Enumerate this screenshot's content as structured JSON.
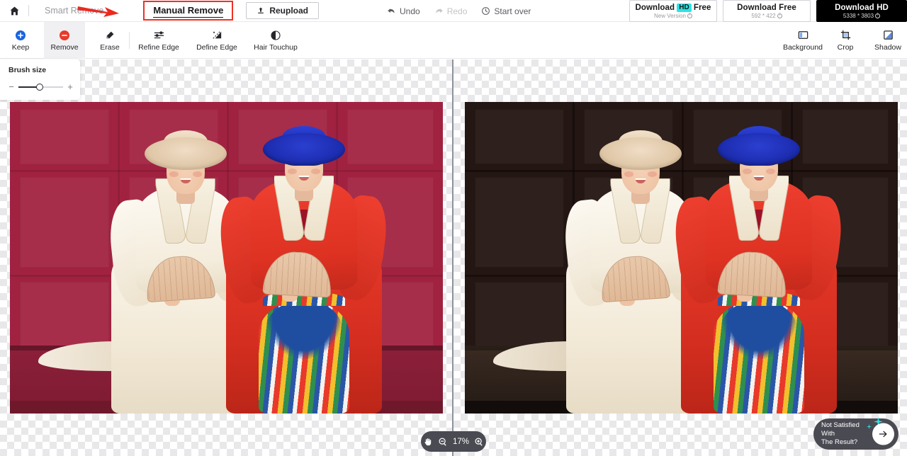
{
  "topbar": {
    "home_icon": "home-icon",
    "tabs": [
      {
        "label": "Smart Remove",
        "active": false
      },
      {
        "label": "Manual Remove",
        "active": true
      }
    ],
    "reupload_label": "Reupload",
    "reupload_icon": "upload-icon",
    "history": [
      {
        "label": "Undo",
        "icon": "undo-arrow-icon",
        "enabled": true
      },
      {
        "label": "Redo",
        "icon": "redo-arrow-icon",
        "enabled": false
      },
      {
        "label": "Start over",
        "icon": "clock-reset-icon",
        "enabled": true
      }
    ],
    "downloads": [
      {
        "title_pre": "Download",
        "badge": "HD",
        "title_post": "Free",
        "subtitle": "New Version",
        "dark": false
      },
      {
        "title_pre": "Download Free",
        "badge": "",
        "title_post": "",
        "subtitle": "592 * 422",
        "dark": false
      },
      {
        "title_pre": "Download HD",
        "badge": "",
        "title_post": "",
        "subtitle": "5338 * 3803",
        "dark": true
      }
    ]
  },
  "toolbar": {
    "left_tools": [
      {
        "label": "Keep",
        "icon": "plus-circle-icon",
        "selected": false
      },
      {
        "label": "Remove",
        "icon": "minus-circle-icon",
        "selected": true
      },
      {
        "label": "Erase",
        "icon": "eraser-icon",
        "selected": false
      },
      {
        "label": "Refine Edge",
        "icon": "sliders-icon",
        "selected": false
      },
      {
        "label": "Define Edge",
        "icon": "edge-pen-icon",
        "selected": false
      },
      {
        "label": "Hair Touchup",
        "icon": "hair-contrast-icon",
        "selected": false
      }
    ],
    "right_tools": [
      {
        "label": "Background",
        "icon": "background-panel-icon"
      },
      {
        "label": "Crop",
        "icon": "crop-icon"
      },
      {
        "label": "Shadow",
        "icon": "shadow-icon"
      }
    ]
  },
  "brush_panel": {
    "title": "Brush size",
    "minus": "−",
    "plus": "+"
  },
  "zoombar": {
    "hand_icon": "hand-pan-icon",
    "zoom_out_icon": "zoom-out-icon",
    "zoom_level": "17%",
    "zoom_in_icon": "zoom-in-icon"
  },
  "cta": {
    "line1": "Not Satisfied With",
    "line2": "The Result?",
    "arrow_icon": "arrow-right-icon",
    "sparkle_icon": "sparkle-icon"
  },
  "canvas": {
    "left_photo_alt": "original-photo-red-background",
    "right_photo_alt": "result-photo-dark-background",
    "divider": "comparison-slider-divider"
  },
  "annotation": {
    "arrow_icon": "red-annotation-arrow",
    "highlight_color": "#ef3124"
  },
  "colors": {
    "accent_red": "#ef3124",
    "badge_cyan": "#2ee3e3",
    "toolbar_selected": "#f0f0f2",
    "pill_gray": "#4a4a52"
  }
}
